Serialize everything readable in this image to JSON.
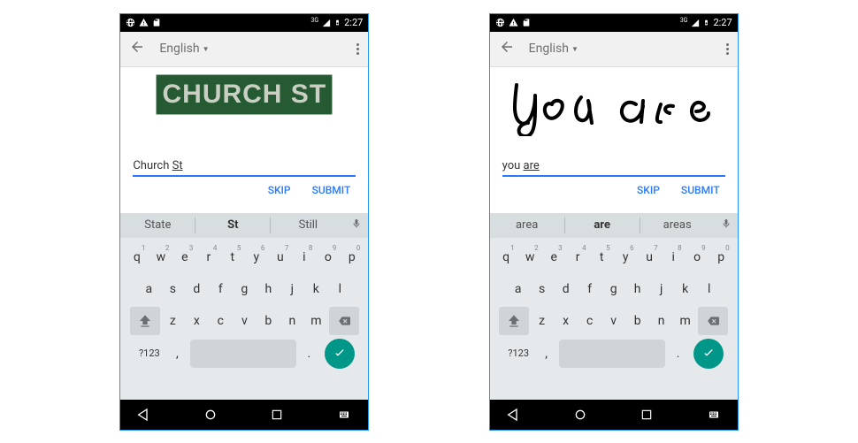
{
  "screens": [
    {
      "status": {
        "net_label": "3G",
        "time": "2:27"
      },
      "toolbar": {
        "language": "English"
      },
      "image_text": "CHURCH ST",
      "input": {
        "word1": "Church",
        "word2": "St"
      },
      "actions": {
        "skip": "SKIP",
        "submit": "SUBMIT"
      },
      "suggestions": {
        "left": "State",
        "center": "St",
        "right": "Still"
      },
      "keyboard": {
        "row1": [
          [
            "q",
            "1"
          ],
          [
            "w",
            "2"
          ],
          [
            "e",
            "3"
          ],
          [
            "r",
            "4"
          ],
          [
            "t",
            "5"
          ],
          [
            "y",
            "6"
          ],
          [
            "u",
            "7"
          ],
          [
            "i",
            "8"
          ],
          [
            "o",
            "9"
          ],
          [
            "p",
            "0"
          ]
        ],
        "row2": [
          "a",
          "s",
          "d",
          "f",
          "g",
          "h",
          "j",
          "k",
          "l"
        ],
        "row3": [
          "z",
          "x",
          "c",
          "v",
          "b",
          "n",
          "m"
        ],
        "sym": "?123",
        "comma": ",",
        "period": "."
      }
    },
    {
      "status": {
        "net_label": "3G",
        "time": "2:27"
      },
      "toolbar": {
        "language": "English"
      },
      "handwriting_text": "you are",
      "input": {
        "word1": "you",
        "word2": "are"
      },
      "actions": {
        "skip": "SKIP",
        "submit": "SUBMIT"
      },
      "suggestions": {
        "left": "area",
        "center": "are",
        "right": "areas"
      },
      "keyboard": {
        "row1": [
          [
            "q",
            "1"
          ],
          [
            "w",
            "2"
          ],
          [
            "e",
            "3"
          ],
          [
            "r",
            "4"
          ],
          [
            "t",
            "5"
          ],
          [
            "y",
            "6"
          ],
          [
            "u",
            "7"
          ],
          [
            "i",
            "8"
          ],
          [
            "o",
            "9"
          ],
          [
            "p",
            "0"
          ]
        ],
        "row2": [
          "a",
          "s",
          "d",
          "f",
          "g",
          "h",
          "j",
          "k",
          "l"
        ],
        "row3": [
          "z",
          "x",
          "c",
          "v",
          "b",
          "n",
          "m"
        ],
        "sym": "?123",
        "comma": ",",
        "period": "."
      }
    }
  ]
}
